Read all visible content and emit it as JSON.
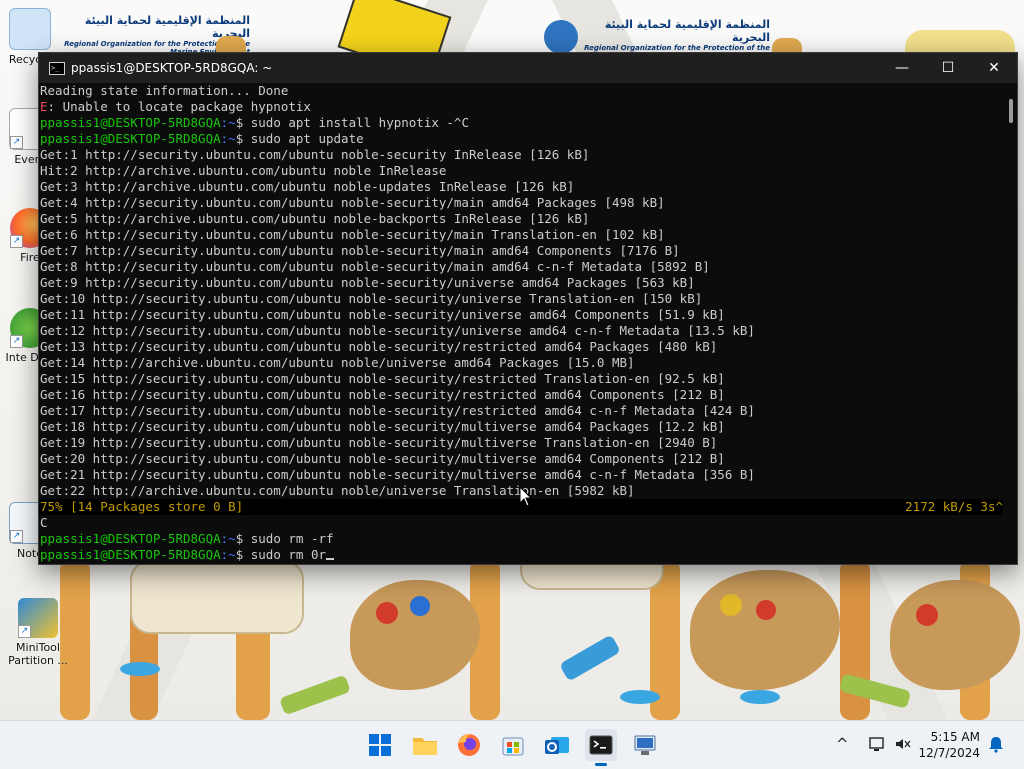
{
  "desktop": {
    "banner_left_ar": "المنظمة الإقليمية لحماية البيئة البحرية",
    "banner_left_en": "Regional Organization for the Protection of the Marine Environment",
    "banner_right_ar": "المنظمة الإقليمية لحماية البيئة البحرية",
    "banner_right_en": "Regional Organization for the Protection of the Marine Environment",
    "icons": [
      {
        "label": "Recycle",
        "name": "recycle-bin-icon"
      },
      {
        "label": "Every",
        "name": "everything-icon"
      },
      {
        "label": "Fire",
        "name": "firefox-desktop-icon"
      },
      {
        "label": "Inte Dow",
        "name": "internet-download-manager-icon"
      },
      {
        "label": "Note",
        "name": "notepad-icon"
      },
      {
        "label": "MiniTool Partition ...",
        "name": "minitool-partition-icon"
      }
    ]
  },
  "terminal": {
    "title": "ppassis1@DESKTOP-5RD8GQA: ~",
    "controls": {
      "minimize": "—",
      "maximize": "☐",
      "close": "✕"
    },
    "lines": [
      {
        "t": "plain",
        "text": "Reading state information... Done"
      },
      {
        "t": "error",
        "prefix": "E",
        "text": ": Unable to locate package hypnotix"
      },
      {
        "t": "prompt",
        "user": "ppassis1@DESKTOP-5RD8GQA",
        "path": ":~",
        "cmd": "$ sudo apt install hypnotix -^C"
      },
      {
        "t": "prompt",
        "user": "ppassis1@DESKTOP-5RD8GQA",
        "path": ":~",
        "cmd": "$ sudo apt update"
      },
      {
        "t": "plain",
        "text": "Get:1 http://security.ubuntu.com/ubuntu noble-security InRelease [126 kB]"
      },
      {
        "t": "plain",
        "text": "Hit:2 http://archive.ubuntu.com/ubuntu noble InRelease"
      },
      {
        "t": "plain",
        "text": "Get:3 http://archive.ubuntu.com/ubuntu noble-updates InRelease [126 kB]"
      },
      {
        "t": "plain",
        "text": "Get:4 http://security.ubuntu.com/ubuntu noble-security/main amd64 Packages [498 kB]"
      },
      {
        "t": "plain",
        "text": "Get:5 http://archive.ubuntu.com/ubuntu noble-backports InRelease [126 kB]"
      },
      {
        "t": "plain",
        "text": "Get:6 http://security.ubuntu.com/ubuntu noble-security/main Translation-en [102 kB]"
      },
      {
        "t": "plain",
        "text": "Get:7 http://security.ubuntu.com/ubuntu noble-security/main amd64 Components [7176 B]"
      },
      {
        "t": "plain",
        "text": "Get:8 http://security.ubuntu.com/ubuntu noble-security/main amd64 c-n-f Metadata [5892 B]"
      },
      {
        "t": "plain",
        "text": "Get:9 http://security.ubuntu.com/ubuntu noble-security/universe amd64 Packages [563 kB]"
      },
      {
        "t": "plain",
        "text": "Get:10 http://security.ubuntu.com/ubuntu noble-security/universe Translation-en [150 kB]"
      },
      {
        "t": "plain",
        "text": "Get:11 http://security.ubuntu.com/ubuntu noble-security/universe amd64 Components [51.9 kB]"
      },
      {
        "t": "plain",
        "text": "Get:12 http://security.ubuntu.com/ubuntu noble-security/universe amd64 c-n-f Metadata [13.5 kB]"
      },
      {
        "t": "plain",
        "text": "Get:13 http://security.ubuntu.com/ubuntu noble-security/restricted amd64 Packages [480 kB]"
      },
      {
        "t": "plain",
        "text": "Get:14 http://archive.ubuntu.com/ubuntu noble/universe amd64 Packages [15.0 MB]"
      },
      {
        "t": "plain",
        "text": "Get:15 http://security.ubuntu.com/ubuntu noble-security/restricted Translation-en [92.5 kB]"
      },
      {
        "t": "plain",
        "text": "Get:16 http://security.ubuntu.com/ubuntu noble-security/restricted amd64 Components [212 B]"
      },
      {
        "t": "plain",
        "text": "Get:17 http://security.ubuntu.com/ubuntu noble-security/restricted amd64 c-n-f Metadata [424 B]"
      },
      {
        "t": "plain",
        "text": "Get:18 http://security.ubuntu.com/ubuntu noble-security/multiverse amd64 Packages [12.2 kB]"
      },
      {
        "t": "plain",
        "text": "Get:19 http://security.ubuntu.com/ubuntu noble-security/multiverse Translation-en [2940 B]"
      },
      {
        "t": "plain",
        "text": "Get:20 http://security.ubuntu.com/ubuntu noble-security/multiverse amd64 Components [212 B]"
      },
      {
        "t": "plain",
        "text": "Get:21 http://security.ubuntu.com/ubuntu noble-security/multiverse amd64 c-n-f Metadata [356 B]"
      },
      {
        "t": "plain",
        "text": "Get:22 http://archive.ubuntu.com/ubuntu noble/universe Translation-en [5982 kB]"
      },
      {
        "t": "progress",
        "text": "75% [14 Packages store 0 B]",
        "rate": "2172 kB/s 3s^"
      },
      {
        "t": "plain",
        "text": "C"
      },
      {
        "t": "prompt",
        "user": "ppassis1@DESKTOP-5RD8GQA",
        "path": ":~",
        "cmd": "$ sudo rm -rf"
      },
      {
        "t": "prompt",
        "user": "ppassis1@DESKTOP-5RD8GQA",
        "path": ":~",
        "cmd": "$ sudo rm 0r",
        "cursor": true
      }
    ]
  },
  "taskbar": {
    "apps": [
      {
        "name": "start-button-icon"
      },
      {
        "name": "file-explorer-icon"
      },
      {
        "name": "firefox-icon"
      },
      {
        "name": "microsoft-store-icon"
      },
      {
        "name": "outlook-icon"
      },
      {
        "name": "terminal-icon",
        "active": true
      },
      {
        "name": "remote-desktop-icon"
      }
    ],
    "clock_time": "5:15 AM",
    "clock_date": "12/7/2024"
  },
  "colors": {
    "terminal_bg": "#0c0c0c",
    "prompt_user": "#16c60c",
    "prompt_path": "#3b78ff",
    "error": "#e74856",
    "progress": "#c19c00"
  }
}
